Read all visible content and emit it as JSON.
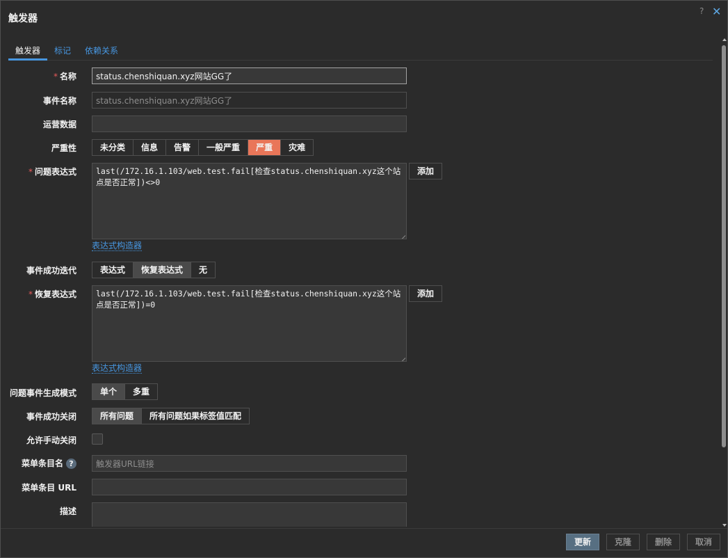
{
  "dialog": {
    "title": "触发器",
    "help": "?",
    "close": "✕"
  },
  "tabs": [
    {
      "label": "触发器",
      "active": true
    },
    {
      "label": "标记",
      "active": false
    },
    {
      "label": "依赖关系",
      "active": false
    }
  ],
  "form": {
    "name": {
      "label": "名称",
      "required": "*",
      "value": "status.chenshiquan.xyz网站GG了"
    },
    "event_name": {
      "label": "事件名称",
      "placeholder": "status.chenshiquan.xyz网站GG了"
    },
    "opdata": {
      "label": "运营数据",
      "value": ""
    },
    "severity": {
      "label": "严重性",
      "options": [
        "未分类",
        "信息",
        "告警",
        "一般严重",
        "严重",
        "灾难"
      ],
      "selected": "严重",
      "selected_color": "#e97659"
    },
    "problem_expression": {
      "label": "问题表达式",
      "required": "*",
      "value": "last(/172.16.1.103/web.test.fail[检查status.chenshiquan.xyz这个站点是否正常])<>0",
      "add_label": "添加",
      "builder_label": "表达式构造器"
    },
    "recovery_mode": {
      "label": "事件成功迭代",
      "options": [
        "表达式",
        "恢复表达式",
        "无"
      ],
      "selected": "恢复表达式"
    },
    "recovery_expression": {
      "label": "恢复表达式",
      "required": "*",
      "value": "last(/172.16.1.103/web.test.fail[检查status.chenshiquan.xyz这个站点是否正常])=0",
      "add_label": "添加",
      "builder_label": "表达式构造器"
    },
    "problem_mode": {
      "label": "问题事件生成模式",
      "options": [
        "单个",
        "多重"
      ],
      "selected": "单个"
    },
    "ok_close": {
      "label": "事件成功关闭",
      "options": [
        "所有问题",
        "所有问题如果标签值匹配"
      ],
      "selected": "所有问题"
    },
    "manual_close": {
      "label": "允许手动关闭",
      "checked": false
    },
    "url_name": {
      "label": "菜单条目名",
      "help": "?",
      "placeholder": "触发器URL链接"
    },
    "url": {
      "label": "菜单条目 URL",
      "value": ""
    },
    "description": {
      "label": "描述",
      "value": ""
    }
  },
  "footer": {
    "update": "更新",
    "clone": "克隆",
    "delete": "删除",
    "cancel": "取消"
  }
}
